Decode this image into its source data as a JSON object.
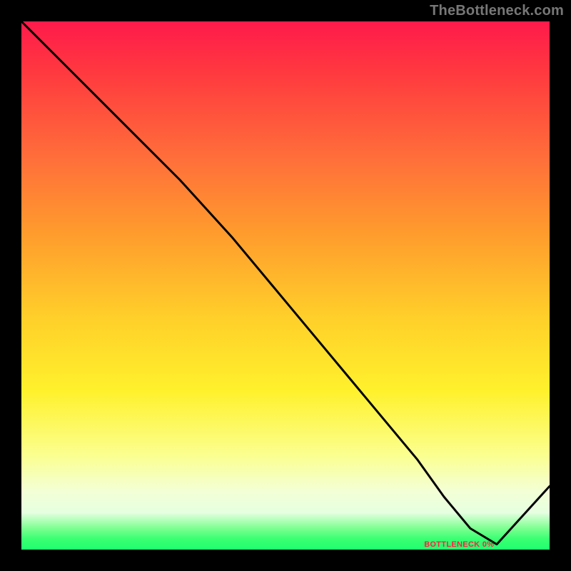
{
  "watermark": "TheBottleneck.com",
  "bottom_label": "BOTTLENECK 0%",
  "chart_data": {
    "type": "line",
    "title": "",
    "xlabel": "",
    "ylabel": "",
    "xlim": [
      0,
      100
    ],
    "ylim": [
      0,
      100
    ],
    "grid": false,
    "legend": null,
    "series": [
      {
        "name": "bottleneck-curve",
        "x": [
          0,
          10,
          22,
          30,
          40,
          50,
          60,
          70,
          75,
          80,
          85,
          90,
          100
        ],
        "values": [
          100,
          90,
          78,
          70,
          59,
          47,
          35,
          23,
          17,
          10,
          4,
          1,
          12
        ]
      }
    ],
    "annotations": [
      {
        "text_key": "bottom_label",
        "x": 83,
        "y": 1
      }
    ],
    "colors": {
      "curve": "#000000",
      "gradient_top": "#ff1a4b",
      "gradient_mid": "#ffd62a",
      "gradient_bottom": "#1fff6e"
    }
  }
}
